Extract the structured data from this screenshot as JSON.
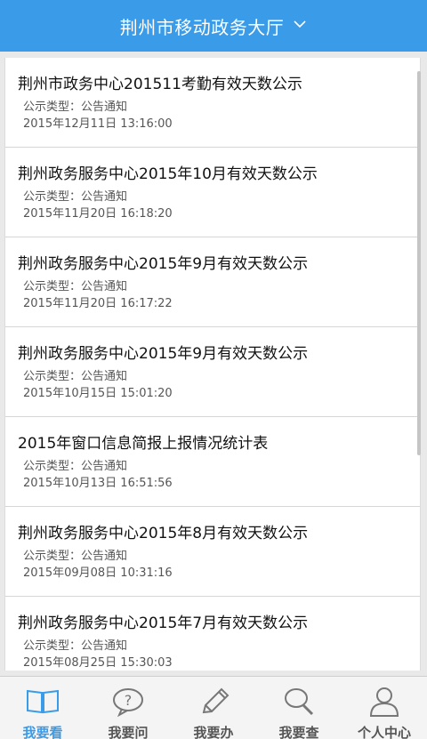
{
  "header": {
    "title": "荆州市移动政务大厅",
    "dropdown_icon": "chevron-down-icon"
  },
  "notices": [
    {
      "title": "荆州市政务中心201511考勤有效天数公示",
      "type": "公示类型：公告通知",
      "date": "2015年12月11日 13:16:00"
    },
    {
      "title": "荆州政务服务中心2015年10月有效天数公示",
      "type": "公示类型：公告通知",
      "date": "2015年11月20日 16:18:20"
    },
    {
      "title": "荆州政务服务中心2015年9月有效天数公示",
      "type": "公示类型：公告通知",
      "date": "2015年11月20日 16:17:22"
    },
    {
      "title": "荆州政务服务中心2015年9月有效天数公示",
      "type": "公示类型：公告通知",
      "date": "2015年10月15日 15:01:20"
    },
    {
      "title": "2015年窗口信息简报上报情况统计表",
      "type": "公示类型：公告通知",
      "date": "2015年10月13日 16:51:56"
    },
    {
      "title": "荆州政务服务中心2015年8月有效天数公示",
      "type": "公示类型：公告通知",
      "date": "2015年09月08日 10:31:16"
    },
    {
      "title": "荆州政务服务中心2015年7月有效天数公示",
      "type": "公示类型：公告通知",
      "date": "2015年08月25日 15:30:03"
    }
  ],
  "tabs": [
    {
      "label": "我要看",
      "icon": "book-icon",
      "active": true
    },
    {
      "label": "我要问",
      "icon": "question-bubble-icon",
      "active": false
    },
    {
      "label": "我要办",
      "icon": "pencil-icon",
      "active": false
    },
    {
      "label": "我要查",
      "icon": "magnifier-icon",
      "active": false
    },
    {
      "label": "个人中心",
      "icon": "person-icon",
      "active": false
    }
  ],
  "colors": {
    "accent": "#3a9be8",
    "tab_inactive": "#555555"
  }
}
